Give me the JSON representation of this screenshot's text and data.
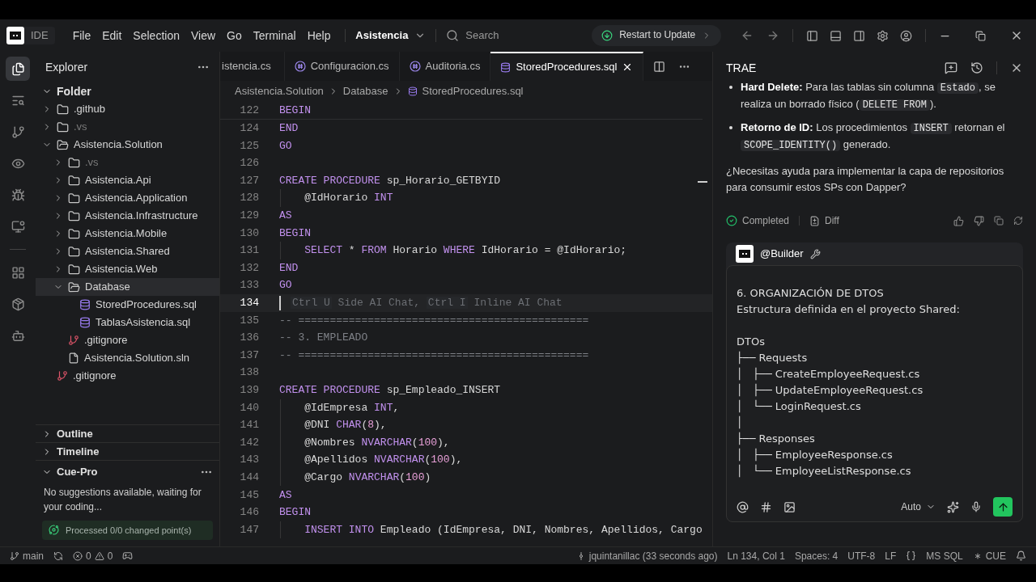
{
  "title_bar": {
    "app_label": "IDE",
    "menus": [
      "File",
      "Edit",
      "Selection",
      "View",
      "Go",
      "Terminal",
      "Help"
    ],
    "project": "Asistencia",
    "search_placeholder": "Search",
    "update_button": "Restart to Update"
  },
  "activity_bar": [
    {
      "kind": "files",
      "selected": true
    },
    {
      "kind": "search",
      "selected": false
    },
    {
      "kind": "git",
      "selected": false
    },
    {
      "kind": "eye",
      "selected": false
    },
    {
      "kind": "debug",
      "selected": false
    },
    {
      "kind": "remote",
      "selected": false
    },
    {
      "kind": "divider"
    },
    {
      "kind": "extensions",
      "selected": false
    },
    {
      "kind": "package",
      "selected": false
    },
    {
      "kind": "bot",
      "selected": false
    }
  ],
  "explorer": {
    "title": "Explorer",
    "root": {
      "label": "Folder",
      "expanded": true
    },
    "tree": [
      {
        "label": ".github",
        "kind": "folder",
        "expanded": false,
        "dimmed": false,
        "selected": false
      },
      {
        "label": ".vs",
        "kind": "folder",
        "expanded": false,
        "dimmed": true,
        "selected": false
      },
      {
        "label": "Asistencia.Solution",
        "kind": "folder",
        "expanded": true,
        "dimmed": false,
        "selected": false,
        "children": [
          {
            "label": ".vs",
            "kind": "folder",
            "expanded": false,
            "dimmed": true,
            "selected": false
          },
          {
            "label": "Asistencia.Api",
            "kind": "folder",
            "expanded": false,
            "dimmed": false,
            "selected": false
          },
          {
            "label": "Asistencia.Application",
            "kind": "folder",
            "expanded": false,
            "dimmed": false,
            "selected": false
          },
          {
            "label": "Asistencia.Infrastructure",
            "kind": "folder",
            "expanded": false,
            "dimmed": false,
            "selected": false
          },
          {
            "label": "Asistencia.Mobile",
            "kind": "folder",
            "expanded": false,
            "dimmed": false,
            "selected": false
          },
          {
            "label": "Asistencia.Shared",
            "kind": "folder",
            "expanded": false,
            "dimmed": false,
            "selected": false
          },
          {
            "label": "Asistencia.Web",
            "kind": "folder",
            "expanded": false,
            "dimmed": false,
            "selected": false
          },
          {
            "label": "Database",
            "kind": "folder",
            "expanded": true,
            "dimmed": false,
            "selected": true,
            "children": [
              {
                "label": "StoredProcedures.sql",
                "kind": "database",
                "dimmed": false,
                "selected": false
              },
              {
                "label": "TablasAsistencia.sql",
                "kind": "database",
                "dimmed": false,
                "selected": false
              }
            ]
          },
          {
            "label": ".gitignore",
            "kind": "git",
            "dimmed": false,
            "selected": false
          },
          {
            "label": "Asistencia.Solution.sln",
            "kind": "file",
            "dimmed": false,
            "selected": false
          }
        ]
      },
      {
        "label": ".gitignore",
        "kind": "git",
        "dimmed": false,
        "selected": false
      }
    ]
  },
  "panels": [
    {
      "label": "Outline",
      "expanded": false
    },
    {
      "label": "Timeline",
      "expanded": false
    }
  ],
  "cue_pro": {
    "title": "Cue-Pro",
    "expanded": true,
    "message": "No suggestions available, waiting for your coding...",
    "status": "Processed 0/0 changed point(s)"
  },
  "tabs": [
    {
      "label": "istencia.cs",
      "kind": "csharp",
      "selected": false
    },
    {
      "label": "Configuracion.cs",
      "kind": "csharp",
      "selected": false
    },
    {
      "label": "Auditoria.cs",
      "kind": "csharp",
      "selected": false
    },
    {
      "label": "StoredProcedures.sql",
      "kind": "sql",
      "selected": true
    }
  ],
  "breadcrumb": [
    "Asistencia.Solution",
    "Database",
    "StoredProcedures.sql"
  ],
  "sticky_line": {
    "number": "122",
    "tokens": [
      {
        "kind": "kw",
        "text": "BEGIN"
      }
    ]
  },
  "code_lines": [
    {
      "number": "124",
      "current": false,
      "tokens": [
        {
          "kind": "kw",
          "text": "END"
        }
      ]
    },
    {
      "number": "125",
      "current": false,
      "tokens": [
        {
          "kind": "kw",
          "text": "GO"
        }
      ]
    },
    {
      "number": "126",
      "current": false
    },
    {
      "number": "127",
      "current": false,
      "tokens": [
        {
          "kind": "kw",
          "text": "CREATE PROCEDURE"
        },
        {
          "kind": "id",
          "text": " sp_Horario_GETBYID"
        }
      ]
    },
    {
      "number": "128",
      "current": false,
      "tokens": [
        {
          "kind": "id",
          "text": "    @IdHorario "
        },
        {
          "kind": "kw",
          "text": "INT"
        }
      ]
    },
    {
      "number": "129",
      "current": false,
      "tokens": [
        {
          "kind": "kw",
          "text": "AS"
        }
      ]
    },
    {
      "number": "130",
      "current": false,
      "tokens": [
        {
          "kind": "kw",
          "text": "BEGIN"
        }
      ]
    },
    {
      "number": "131",
      "current": false,
      "tokens": [
        {
          "kind": "kw",
          "text": "    SELECT"
        },
        {
          "kind": "id",
          "text": " * "
        },
        {
          "kind": "kw",
          "text": "FROM"
        },
        {
          "kind": "id",
          "text": " Horario "
        },
        {
          "kind": "kw",
          "text": "WHERE"
        },
        {
          "kind": "id",
          "text": " IdHorario = @IdHorario;"
        }
      ]
    },
    {
      "number": "132",
      "current": false,
      "tokens": [
        {
          "kind": "kw",
          "text": "END"
        }
      ]
    },
    {
      "number": "133",
      "current": false,
      "tokens": [
        {
          "kind": "kw",
          "text": "GO"
        }
      ]
    },
    {
      "number": "134",
      "current": true,
      "tokens": [
        {
          "kind": "key",
          "text": "Ctrl U"
        },
        {
          "kind": "hint",
          "text": " Side AI Chat, "
        },
        {
          "kind": "key",
          "text": "Ctrl I"
        },
        {
          "kind": "hint",
          "text": " Inline AI Chat"
        }
      ]
    },
    {
      "number": "135",
      "current": false,
      "tokens": [
        {
          "kind": "com",
          "text": "-- =============================================="
        }
      ]
    },
    {
      "number": "136",
      "current": false,
      "tokens": [
        {
          "kind": "com",
          "text": "-- 3. EMPLEADO"
        }
      ]
    },
    {
      "number": "137",
      "current": false,
      "tokens": [
        {
          "kind": "com",
          "text": "-- =============================================="
        }
      ]
    },
    {
      "number": "138",
      "current": false
    },
    {
      "number": "139",
      "current": false,
      "tokens": [
        {
          "kind": "kw",
          "text": "CREATE PROCEDURE"
        },
        {
          "kind": "id",
          "text": " sp_Empleado_INSERT"
        }
      ]
    },
    {
      "number": "140",
      "current": false,
      "tokens": [
        {
          "kind": "id",
          "text": "    @IdEmpresa "
        },
        {
          "kind": "kw",
          "text": "INT"
        },
        {
          "kind": "id",
          "text": ","
        }
      ]
    },
    {
      "number": "141",
      "current": false,
      "tokens": [
        {
          "kind": "id",
          "text": "    @DNI "
        },
        {
          "kind": "kw",
          "text": "CHAR"
        },
        {
          "kind": "id",
          "text": "("
        },
        {
          "kind": "num",
          "text": "8"
        },
        {
          "kind": "id",
          "text": "),"
        }
      ]
    },
    {
      "number": "142",
      "current": false,
      "tokens": [
        {
          "kind": "id",
          "text": "    @Nombres "
        },
        {
          "kind": "kw",
          "text": "NVARCHAR"
        },
        {
          "kind": "id",
          "text": "("
        },
        {
          "kind": "num",
          "text": "100"
        },
        {
          "kind": "id",
          "text": "),"
        }
      ]
    },
    {
      "number": "143",
      "current": false,
      "tokens": [
        {
          "kind": "id",
          "text": "    @Apellidos "
        },
        {
          "kind": "kw",
          "text": "NVARCHAR"
        },
        {
          "kind": "id",
          "text": "("
        },
        {
          "kind": "num",
          "text": "100"
        },
        {
          "kind": "id",
          "text": "),"
        }
      ]
    },
    {
      "number": "144",
      "current": false,
      "tokens": [
        {
          "kind": "id",
          "text": "    @Cargo "
        },
        {
          "kind": "kw",
          "text": "NVARCHAR"
        },
        {
          "kind": "id",
          "text": "("
        },
        {
          "kind": "num",
          "text": "100"
        },
        {
          "kind": "id",
          "text": ")"
        }
      ]
    },
    {
      "number": "145",
      "current": false,
      "tokens": [
        {
          "kind": "kw",
          "text": "AS"
        }
      ]
    },
    {
      "number": "146",
      "current": false,
      "tokens": [
        {
          "kind": "kw",
          "text": "BEGIN"
        }
      ]
    },
    {
      "number": "147",
      "current": false,
      "tokens": [
        {
          "kind": "kw",
          "text": "    INSERT INTO"
        },
        {
          "kind": "id",
          "text": " Empleado (IdEmpresa, DNI, Nombres, Apellidos, Cargo"
        }
      ]
    }
  ],
  "chat": {
    "title": "TRAE",
    "bullets": [
      [
        {
          "kind": "bold",
          "text": "Hard Delete:"
        },
        {
          "kind": "text",
          "text": " Para las tablas sin columna "
        },
        {
          "kind": "code",
          "text": "Estado"
        },
        {
          "kind": "text",
          "text": ", se realiza un borrado físico ("
        },
        {
          "kind": "code",
          "text": "DELETE FROM"
        },
        {
          "kind": "text",
          "text": ")."
        }
      ],
      [
        {
          "kind": "bold",
          "text": "Retorno de ID:"
        },
        {
          "kind": "text",
          "text": " Los procedimientos "
        },
        {
          "kind": "code",
          "text": "INSERT"
        },
        {
          "kind": "text",
          "text": " retornan el "
        },
        {
          "kind": "code",
          "text": "SCOPE_IDENTITY()"
        },
        {
          "kind": "text",
          "text": " generado."
        }
      ]
    ],
    "question": "¿Necesitas ayuda para implementar la capa de repositorios para consumir estos SPs con Dapper?",
    "status": "Completed",
    "diff_label": "Diff",
    "agent": "@Builder",
    "input_value": "6. ORGANIZACIÓN DE DTOS\nEstructura definida en el proyecto Shared:\n\nDTOs\n├── Requests\n│   ├── CreateEmployeeRequest.cs\n│   ├── UpdateEmployeeRequest.cs\n│   └── LoginRequest.cs\n│\n├── Responses\n│   ├── EmployeeResponse.cs\n│   └── EmployeeListResponse.cs",
    "model": "Auto"
  },
  "status_bar": {
    "branch": "main",
    "errors": "0",
    "warnings": "0",
    "author": "jquintanillac (33 seconds ago)",
    "items": [
      "Ln 134, Col 1",
      "Spaces: 4",
      "UTF-8",
      "LF"
    ],
    "language": "MS SQL",
    "cue": "CUE"
  }
}
